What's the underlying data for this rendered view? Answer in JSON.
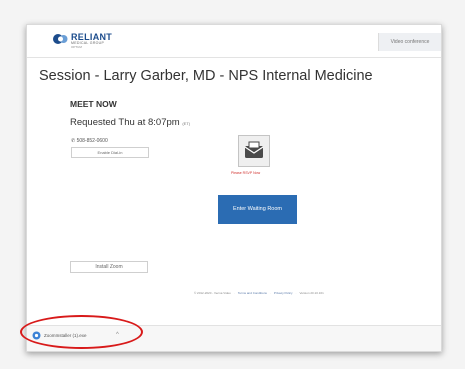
{
  "header": {
    "logo_name": "RELIANT",
    "logo_sub1": "MEDICAL GROUP",
    "logo_sub2": "OPTUM",
    "right_button": "Video conference"
  },
  "session_title": "Session - Larry Garber, MD - NPS Internal Medicine",
  "meet": {
    "heading": "MEET NOW",
    "requested": "Requested Thu at 8:07pm",
    "timezone": "(ET)",
    "phone": "508-852-0600",
    "dial_in_button": "Enable Dial-in"
  },
  "rsvp": {
    "label": "Please RSVP Now"
  },
  "waiting_room_button": "Enter Waiting Room",
  "install_zoom_button": "Install Zoom",
  "footer": {
    "copyright": "© 2012-2020 - Vecna Video",
    "terms": "Terms and Conditions",
    "privacy": "Privacy Policy",
    "version": "Version 20.10.161"
  },
  "download": {
    "filename": "ZoomInstaller (1).exe",
    "close": "^"
  },
  "colors": {
    "brand": "#1c4c8c",
    "primary_button": "#2b6cb3",
    "rsvp_red": "#d0322f",
    "highlight_red": "#d81a1a"
  }
}
